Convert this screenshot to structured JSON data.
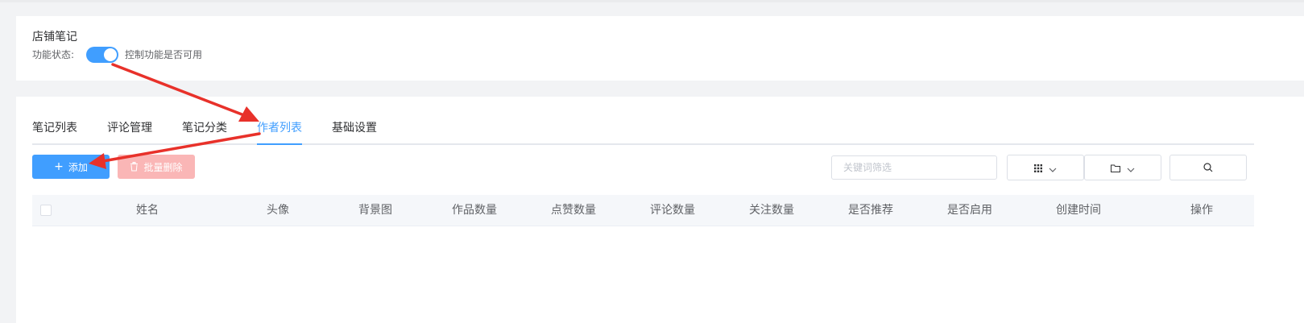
{
  "header": {
    "title": "店铺笔记",
    "status_label": "功能状态:",
    "toggle_on": true,
    "status_desc": "控制功能是否可用"
  },
  "tabs": [
    {
      "label": "笔记列表",
      "active": false
    },
    {
      "label": "评论管理",
      "active": false
    },
    {
      "label": "笔记分类",
      "active": false
    },
    {
      "label": "作者列表",
      "active": true
    },
    {
      "label": "基础设置",
      "active": false
    }
  ],
  "toolbar": {
    "add_label": "添加",
    "add_icon": "plus-icon",
    "batch_delete_label": "批量删除",
    "batch_delete_icon": "trash-icon",
    "search_placeholder": "关键词筛选",
    "grid_icon": "grid-icon",
    "folder_icon": "folder-icon",
    "search_icon": "search-icon"
  },
  "table": {
    "columns": [
      "姓名",
      "头像",
      "背景图",
      "作品数量",
      "点赞数量",
      "评论数量",
      "关注数量",
      "是否推荐",
      "是否启用",
      "创建时间",
      "操作"
    ],
    "rows": []
  },
  "colors": {
    "primary": "#409eff",
    "danger_disabled": "#fab6b6",
    "annotation_arrow": "#e8312a"
  }
}
